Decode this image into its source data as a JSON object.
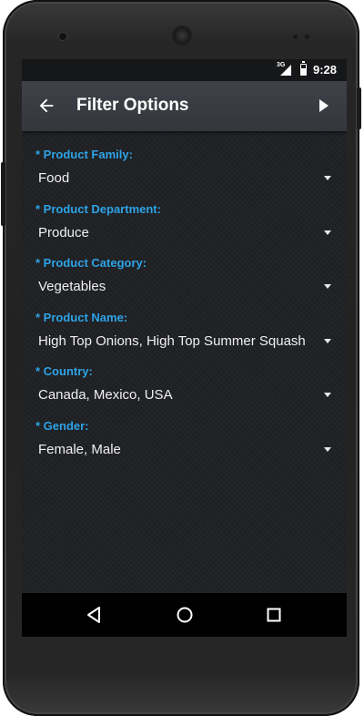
{
  "status_bar": {
    "network": "3G",
    "time": "9:28"
  },
  "app_bar": {
    "title": "Filter Options",
    "back_icon": "arrow-left-icon",
    "apply_icon": "play-icon"
  },
  "filters": [
    {
      "label": "* Product Family:",
      "value": "Food"
    },
    {
      "label": "* Product Department:",
      "value": "Produce"
    },
    {
      "label": "* Product Category:",
      "value": "Vegetables"
    },
    {
      "label": "* Product Name:",
      "value": "High Top Onions, High Top Summer Squash"
    },
    {
      "label": "* Country:",
      "value": "Canada, Mexico, USA"
    },
    {
      "label": "* Gender:",
      "value": "Female, Male"
    }
  ],
  "nav_bar": {
    "back": "triangle-back-icon",
    "home": "circle-home-icon",
    "recents": "square-recents-icon"
  },
  "colors": {
    "label_accent": "#2ea3e6",
    "screen_bg": "#202226",
    "app_bar_bg": "#3a3d42"
  }
}
